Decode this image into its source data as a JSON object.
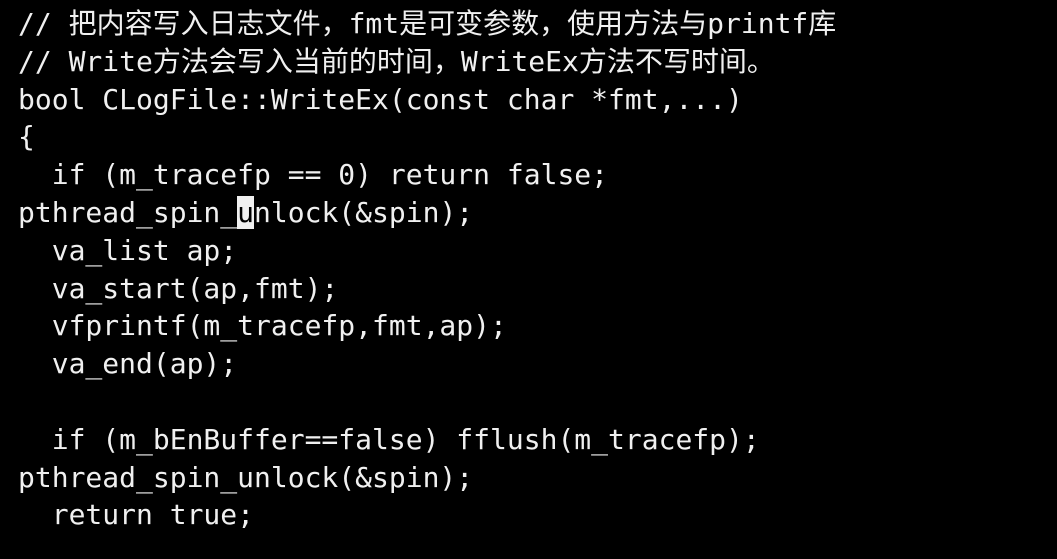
{
  "terminal": {
    "background": "#000000",
    "foreground": "#f0f0f0",
    "lines": [
      "// 把内容写入日志文件，fmt是可变参数，使用方法与printf库",
      "// Write方法会写入当前的时间，WriteEx方法不写时间。",
      "bool CLogFile::WriteEx(const char *fmt,...)",
      "{",
      "  if (m_tracefp == 0) return false;",
      "pthread_spin_unlock(&spin);",
      "  va_list ap;",
      "  va_start(ap,fmt);",
      "  vfprintf(m_tracefp,fmt,ap);",
      "  va_end(ap);",
      "",
      "  if (m_bEnBuffer==false) fflush(m_tracefp);",
      "pthread_spin_unlock(&spin);",
      "  return true;"
    ],
    "cursor_line": {
      "before": "pthread_spin_",
      "cursor_char": "u",
      "after": "nlock(&spin);"
    }
  }
}
